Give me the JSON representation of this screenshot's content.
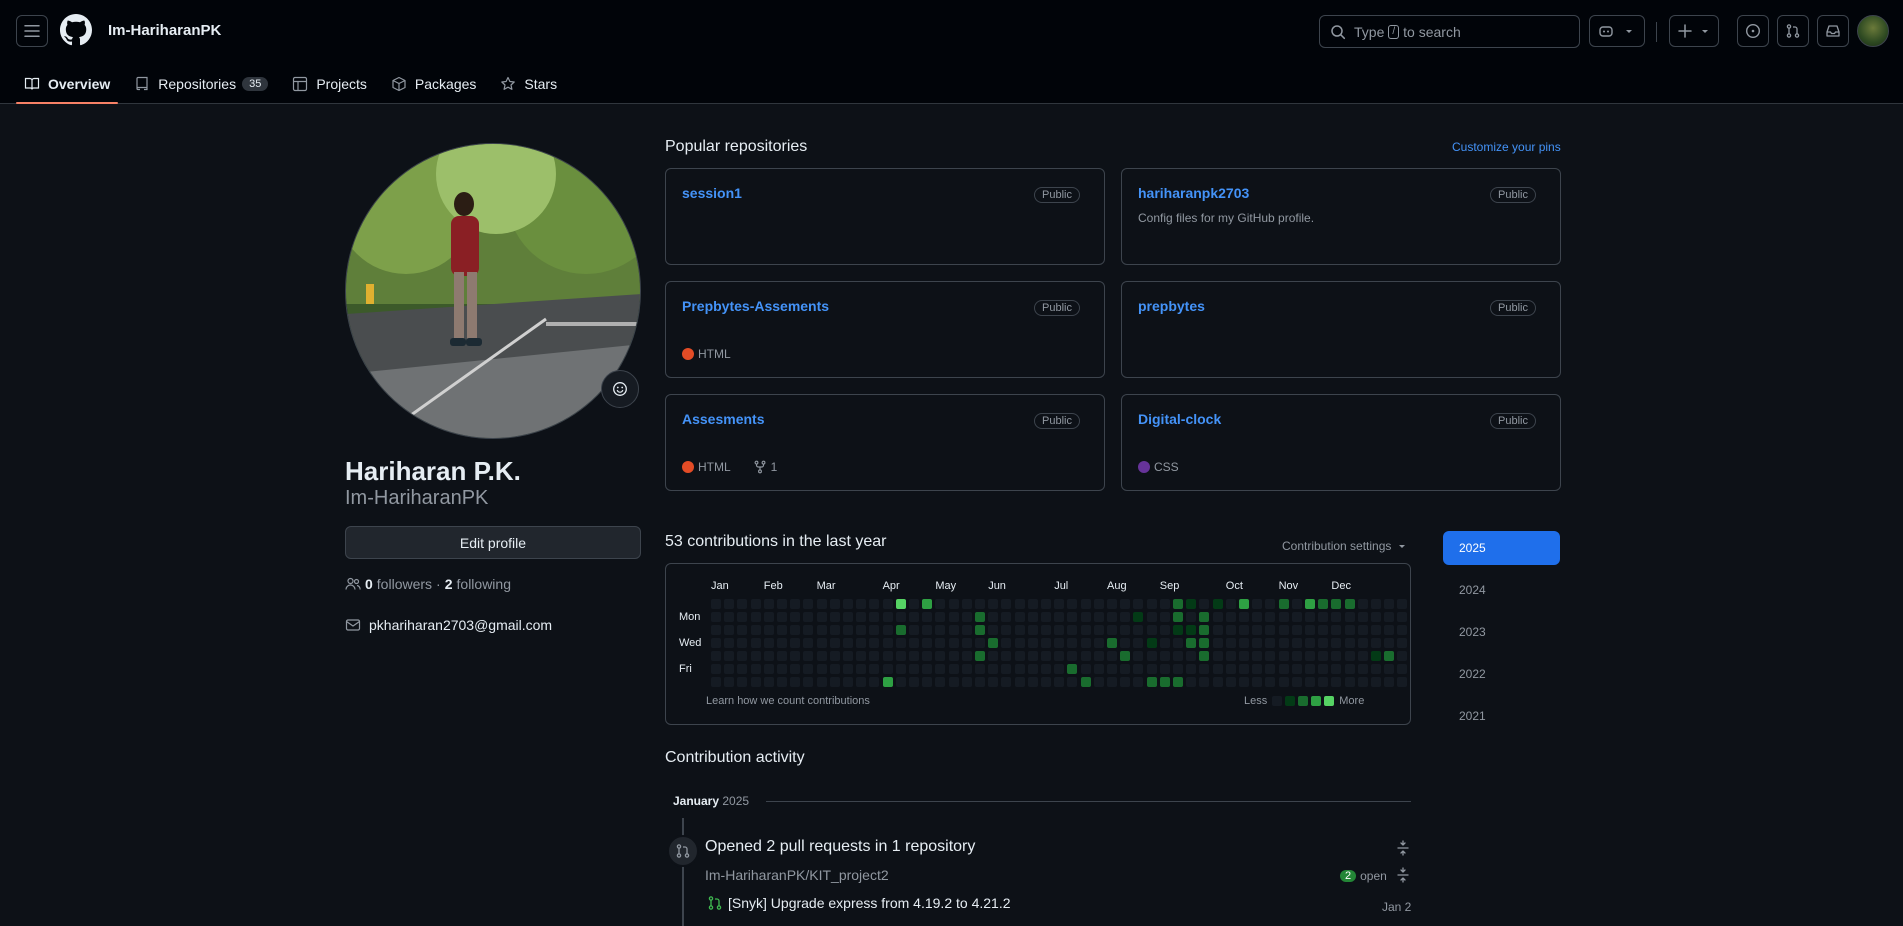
{
  "header": {
    "username": "Im-HariharanPK",
    "search_prefix": "Type",
    "search_key": "/",
    "search_suffix": "to search"
  },
  "tabs": [
    {
      "label": "Overview"
    },
    {
      "label": "Repositories",
      "count": "35"
    },
    {
      "label": "Projects"
    },
    {
      "label": "Packages"
    },
    {
      "label": "Stars"
    }
  ],
  "profile": {
    "full_name": "Hariharan P.K.",
    "login": "Im-HariharanPK",
    "edit_label": "Edit profile",
    "followers_count": "0",
    "followers_label": "followers",
    "separator": "·",
    "following_count": "2",
    "following_label": "following",
    "email": "pkhariharan2703@gmail.com"
  },
  "popular": {
    "title": "Popular repositories",
    "customize_label": "Customize your pins",
    "repos": [
      {
        "name": "session1",
        "visibility": "Public",
        "description": "",
        "language": "",
        "lang_color": "",
        "forks": ""
      },
      {
        "name": "hariharanpk2703",
        "visibility": "Public",
        "description": "Config files for my GitHub profile.",
        "language": "",
        "lang_color": "",
        "forks": ""
      },
      {
        "name": "Prepbytes-Assements",
        "visibility": "Public",
        "description": "",
        "language": "HTML",
        "lang_color": "#e34c26",
        "forks": ""
      },
      {
        "name": "prepbytes",
        "visibility": "Public",
        "description": "",
        "language": "",
        "lang_color": "",
        "forks": ""
      },
      {
        "name": "Assesments",
        "visibility": "Public",
        "description": "",
        "language": "HTML",
        "lang_color": "#e34c26",
        "forks": "1"
      },
      {
        "name": "Digital-clock",
        "visibility": "Public",
        "description": "",
        "language": "CSS",
        "lang_color": "#663399",
        "forks": ""
      }
    ]
  },
  "contributions": {
    "title": "53 contributions in the last year",
    "settings_label": "Contribution settings",
    "months": [
      "Jan",
      "Feb",
      "Mar",
      "Apr",
      "May",
      "Jun",
      "Jul",
      "Aug",
      "Sep",
      "Oct",
      "Nov",
      "Dec"
    ],
    "days": [
      "Mon",
      "Wed",
      "Fri"
    ],
    "learn_label": "Learn how we count contributions",
    "less_label": "Less",
    "more_label": "More",
    "colors": [
      "#151b23",
      "#033a16",
      "#196c2e",
      "#2ea043",
      "#56d364"
    ],
    "cells": [
      {
        "w": 14,
        "d": 0,
        "l": 4
      },
      {
        "w": 14,
        "d": 2,
        "l": 2
      },
      {
        "w": 13,
        "d": 6,
        "l": 3
      },
      {
        "w": 16,
        "d": 0,
        "l": 3
      },
      {
        "w": 20,
        "d": 1,
        "l": 2
      },
      {
        "w": 20,
        "d": 2,
        "l": 2
      },
      {
        "w": 21,
        "d": 3,
        "l": 2
      },
      {
        "w": 20,
        "d": 4,
        "l": 2
      },
      {
        "w": 27,
        "d": 5,
        "l": 2
      },
      {
        "w": 28,
        "d": 6,
        "l": 2
      },
      {
        "w": 30,
        "d": 3,
        "l": 2
      },
      {
        "w": 31,
        "d": 4,
        "l": 2
      },
      {
        "w": 32,
        "d": 1,
        "l": 1
      },
      {
        "w": 33,
        "d": 6,
        "l": 2
      },
      {
        "w": 34,
        "d": 6,
        "l": 1
      },
      {
        "w": 35,
        "d": 6,
        "l": 2
      },
      {
        "w": 35,
        "d": 0,
        "l": 2
      },
      {
        "w": 35,
        "d": 1,
        "l": 2
      },
      {
        "w": 36,
        "d": 2,
        "l": 1
      },
      {
        "w": 36,
        "d": 3,
        "l": 2
      },
      {
        "w": 37,
        "d": 1,
        "l": 2
      },
      {
        "w": 37,
        "d": 2,
        "l": 2
      },
      {
        "w": 37,
        "d": 3,
        "l": 2
      },
      {
        "w": 37,
        "d": 4,
        "l": 2
      },
      {
        "w": 38,
        "d": 0,
        "l": 1
      },
      {
        "w": 40,
        "d": 0,
        "l": 3
      },
      {
        "w": 43,
        "d": 0,
        "l": 2
      },
      {
        "w": 45,
        "d": 0,
        "l": 3
      },
      {
        "w": 46,
        "d": 0,
        "l": 2
      },
      {
        "w": 47,
        "d": 0,
        "l": 2
      },
      {
        "w": 48,
        "d": 0,
        "l": 2
      },
      {
        "w": 50,
        "d": 4,
        "l": 1
      },
      {
        "w": 51,
        "d": 4,
        "l": 2
      },
      {
        "w": 36,
        "d": 0,
        "l": 1
      },
      {
        "w": 33,
        "d": 3,
        "l": 1
      },
      {
        "w": 35,
        "d": 2,
        "l": 1
      },
      {
        "w": 34,
        "d": 6,
        "l": 2
      }
    ]
  },
  "years": [
    "2025",
    "2024",
    "2023",
    "2022",
    "2021"
  ],
  "activity": {
    "title": "Contribution activity",
    "month": "January",
    "year": "2025",
    "heading": "Opened 2 pull requests in 1 repository",
    "repo": "Im-HariharanPK/KIT_project2",
    "open_count": "2",
    "open_label": "open",
    "pr_title": "[Snyk] Upgrade express from 4.19.2 to 4.21.2",
    "pr_date": "Jan 2"
  }
}
